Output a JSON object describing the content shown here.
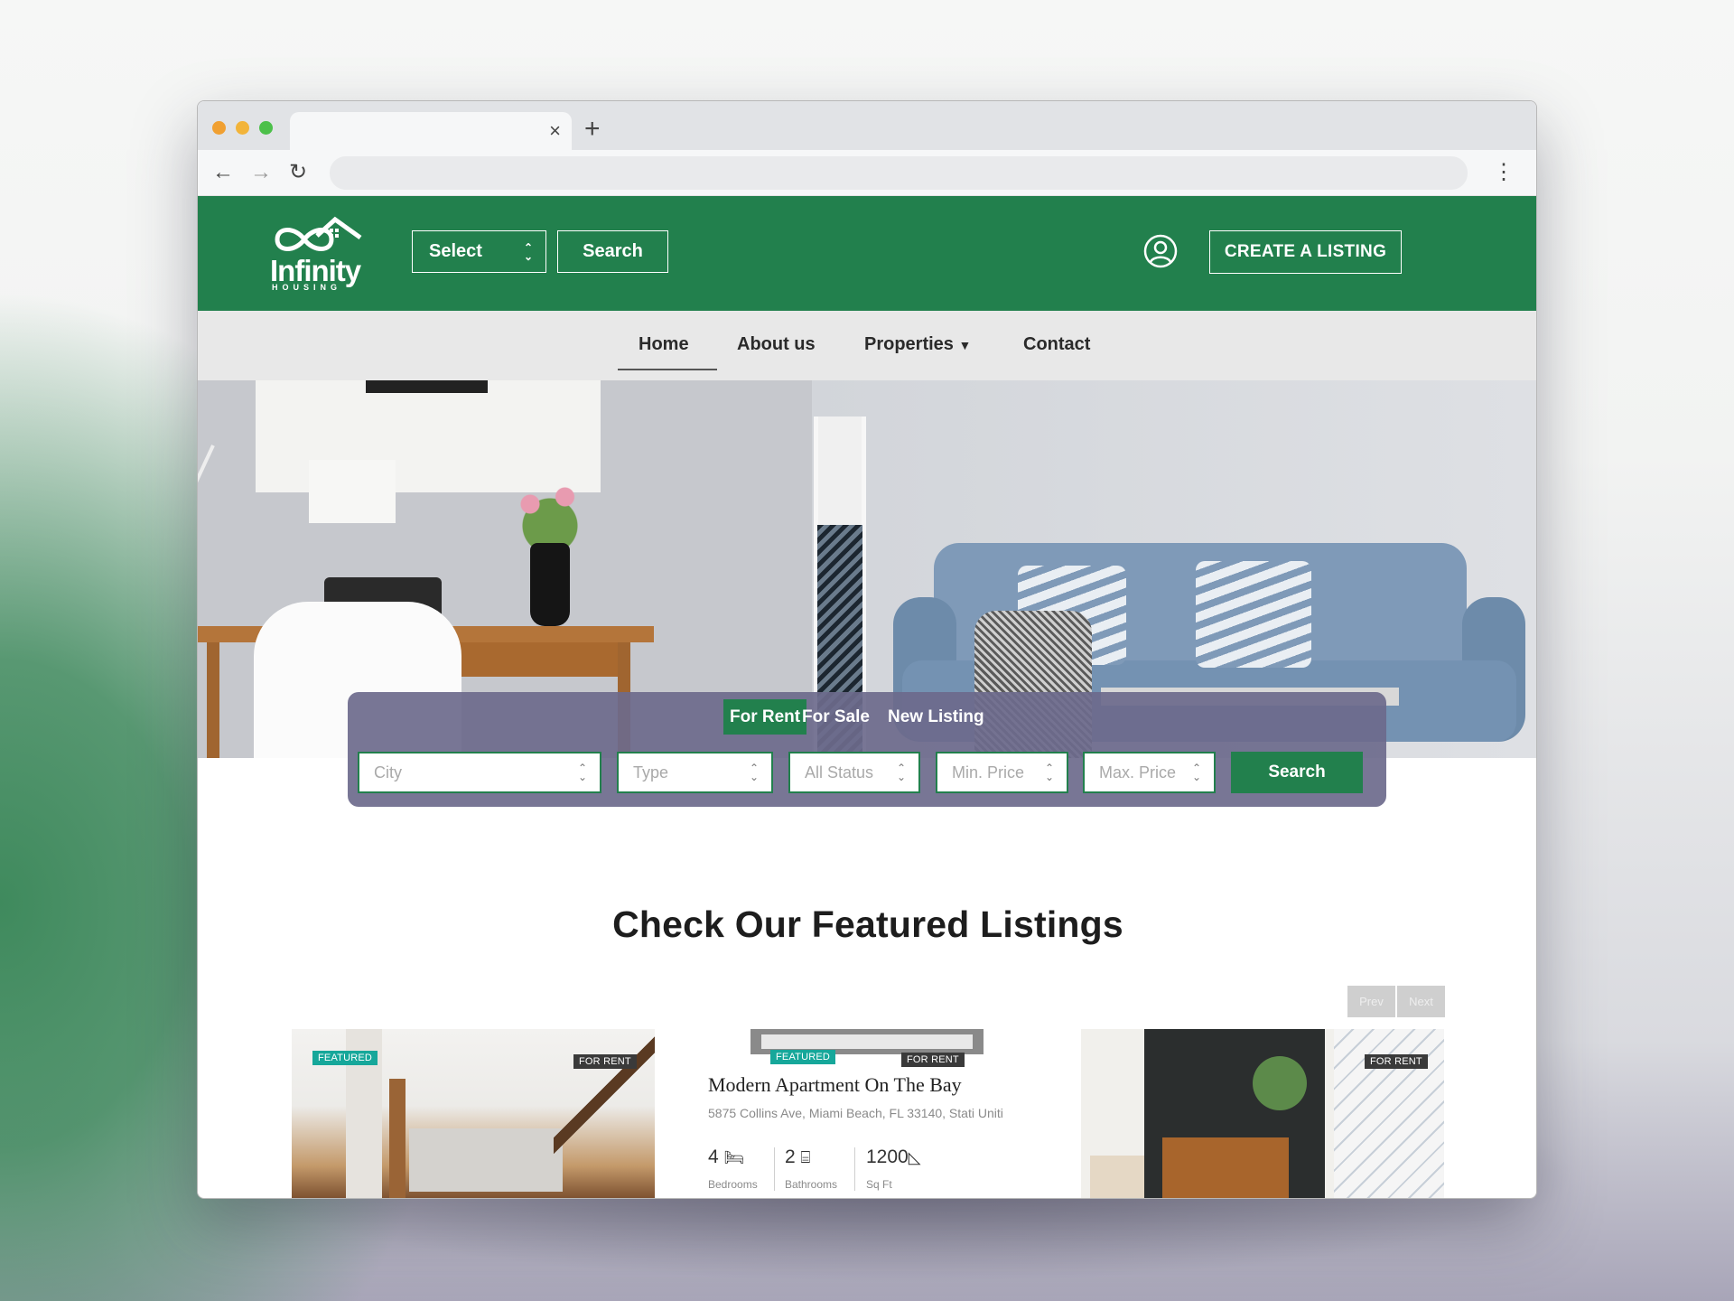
{
  "browser": {
    "dots": [
      "#f5a623",
      "#f0a030",
      "#4cc04a"
    ],
    "tab_close": "×",
    "new_tab": "+",
    "back": "←",
    "forward": "→",
    "reload": "↻",
    "menu": "⋮"
  },
  "header": {
    "logo_text": "Infinity",
    "logo_sub": "HOUSING",
    "select_label": "Select",
    "search_label": "Search",
    "create_listing": "CREATE A LISTING",
    "brand_color": "#22804d"
  },
  "nav": {
    "items": [
      "Home",
      "About us",
      "Properties",
      "Contact"
    ],
    "active": "Home"
  },
  "search_panel": {
    "tabs": [
      "For Rent",
      "For Sale",
      "New Listing"
    ],
    "active_tab": "For Rent",
    "fields": [
      "City",
      "Type",
      "All Status",
      "Min. Price",
      "Max. Price"
    ],
    "button": "Search"
  },
  "featured": {
    "title": "Check Our Featured Listings",
    "prev": "Prev",
    "next": "Next",
    "cards": [
      {
        "badges": [
          "FEATURED",
          "FOR RENT"
        ]
      },
      {
        "badges": [
          "FEATURED",
          "FOR RENT"
        ],
        "title": "Modern Apartment On The Bay",
        "address": "5875 Collins Ave, Miami Beach, FL 33140, Stati Uniti",
        "bedrooms": "4",
        "bedrooms_label": "Bedrooms",
        "bathrooms": "2",
        "bathrooms_label": "Bathrooms",
        "sqft": "1200",
        "sqft_label": "Sq Ft"
      },
      {
        "badges": [
          "FOR RENT"
        ]
      }
    ]
  }
}
